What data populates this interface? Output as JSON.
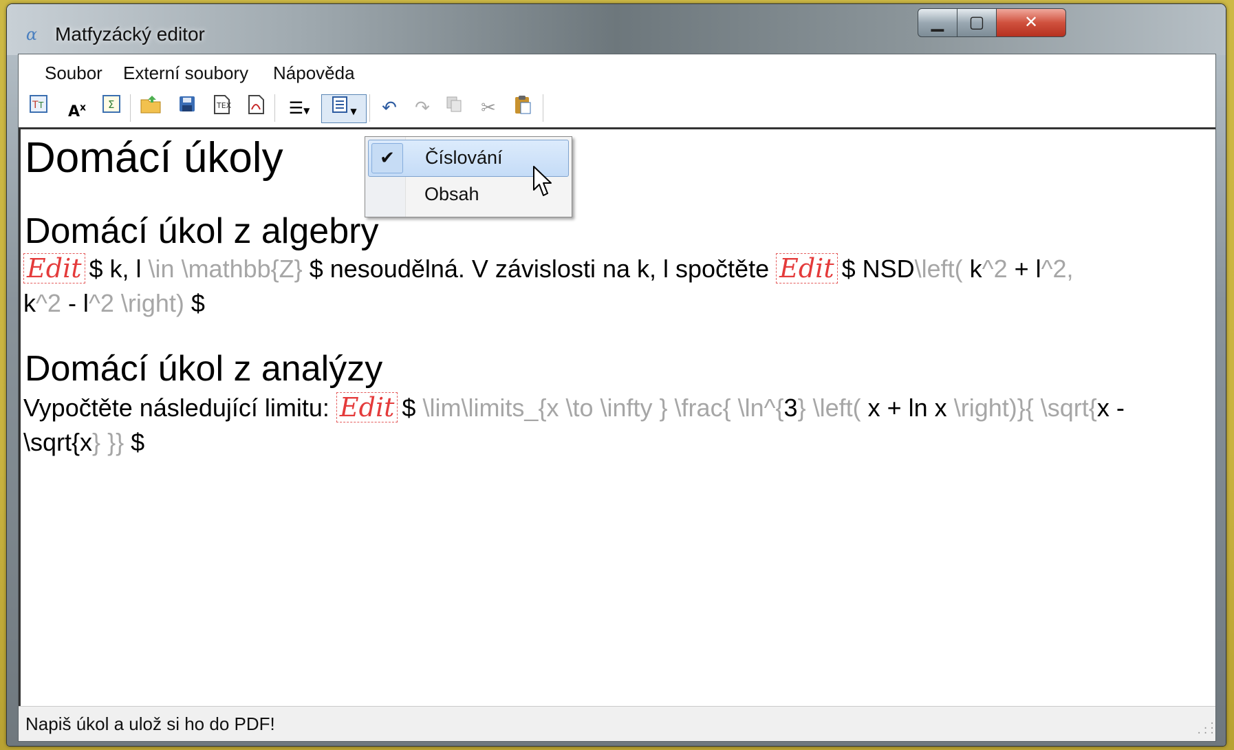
{
  "window": {
    "title": "Matfyzácký editor",
    "app_icon": "α"
  },
  "menu": [
    "Soubor",
    "Externí soubory",
    "Nápověda"
  ],
  "dropdown": {
    "items": [
      {
        "label": "Číslování",
        "checked": true,
        "highlighted": true
      },
      {
        "label": "Obsah",
        "checked": false,
        "highlighted": false
      }
    ]
  },
  "document": {
    "title": "Domácí úkoly",
    "section1": {
      "heading": "Domácí úkol z algebry",
      "edit": "Edit",
      "l1_a": "$ k, l",
      "l1_b": "\\in  \\mathbb{Z}",
      "l1_c": "$ nesoudělná. V závislosti na k, l spočtěte",
      "l1_d": "$ NSD",
      "l1_e": "\\left(",
      "l1_f": "k",
      "l1_g": "^2",
      "l1_h": "+ l",
      "l1_i": "^2,",
      "l2_a": "k",
      "l2_b": "^2",
      "l2_c": "- l",
      "l2_d": "^2 \\right)",
      "l2_e": "$"
    },
    "section2": {
      "heading": "Domácí úkol z analýzy",
      "l1_a": "Vypočtěte následující limitu:",
      "l1_b": "$",
      "l1_c": "\\lim\\limits_{x \\to  \\infty } \\frac{ \\ln^{",
      "l1_d": "3",
      "l1_e": "} \\left(",
      "l1_f": "x + ln x",
      "l1_g": "\\right)}{ \\sqrt{",
      "l1_h": "x -",
      "l2_a": "\\sqrt{",
      "l2_b": "x",
      "l2_c": "} }}",
      "l2_d": "$"
    }
  },
  "status": "Napiš úkol a ulož si ho do PDF!"
}
